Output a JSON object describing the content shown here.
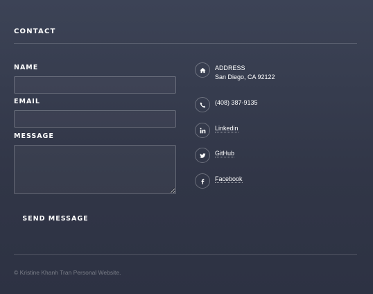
{
  "section": {
    "title": "CONTACT"
  },
  "form": {
    "name_label": "NAME",
    "email_label": "EMAIL",
    "message_label": "MESSAGE",
    "name_value": "",
    "email_value": "",
    "message_value": "",
    "submit_label": "SEND MESSAGE"
  },
  "contact_info": {
    "address_title": "ADDRESS",
    "address_line": "San Diego, CA 92122",
    "phone": "(408) 387-9135",
    "linkedin": "Linkedin",
    "github": "GitHub",
    "facebook": "Facebook"
  },
  "icons": {
    "address": "home-icon",
    "phone": "phone-icon",
    "linkedin": "linkedin-icon",
    "github": "twitter-icon",
    "facebook": "facebook-icon"
  },
  "footer": {
    "copyright": "© Kristine Khanh Tran Personal Website."
  },
  "colors": {
    "background_top": "#3c4356",
    "background_bottom": "#2d3243",
    "text": "#ffffff"
  }
}
